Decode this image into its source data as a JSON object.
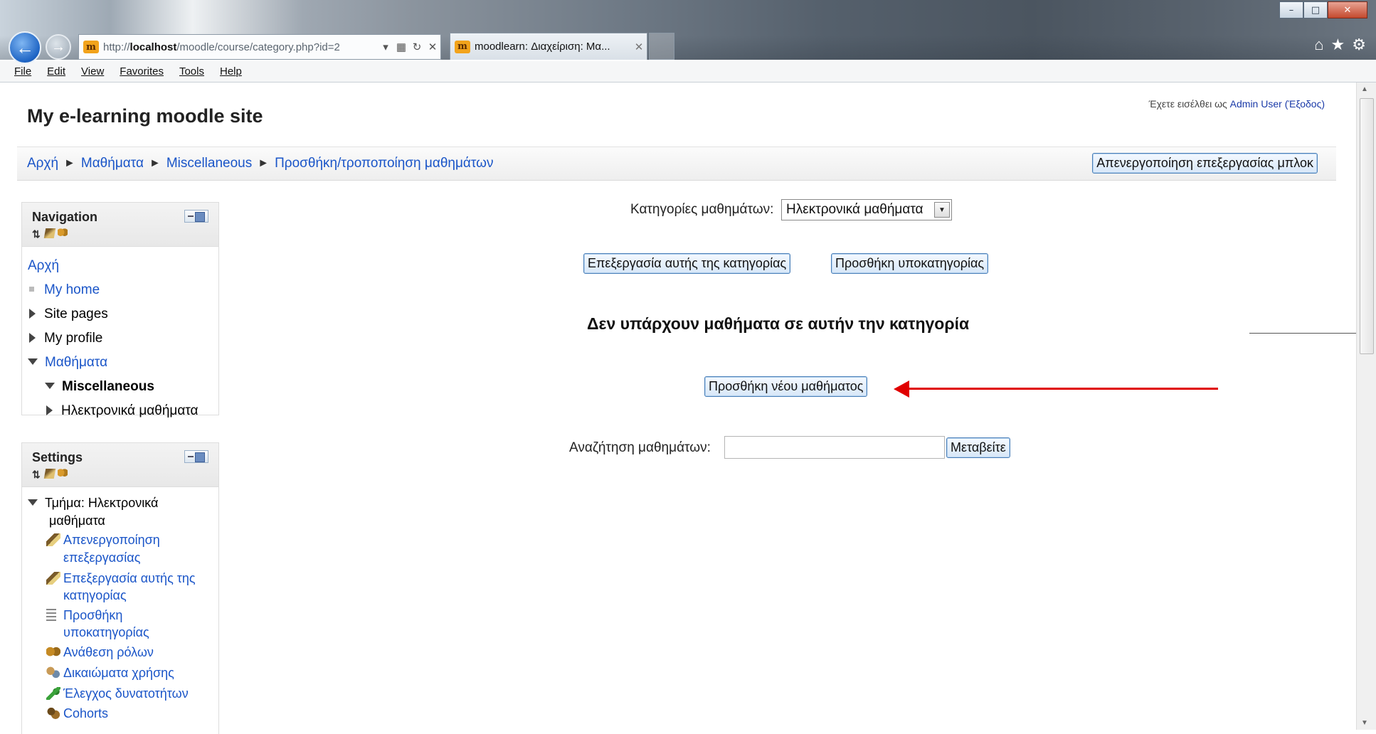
{
  "window": {
    "controls": {
      "minimize": "–",
      "maximize": "□",
      "close": "✕"
    }
  },
  "browser": {
    "url_prefix": "http://",
    "url_host": "localhost",
    "url_path": "/moodle/course/category.php?id=2",
    "tab_title": "moodlearn: Διαχείριση: Μα...",
    "icons": [
      "back-icon",
      "forward-icon",
      "home-icon",
      "favorites-star-icon",
      "settings-gear-icon"
    ]
  },
  "menubar": [
    "File",
    "Edit",
    "View",
    "Favorites",
    "Tools",
    "Help"
  ],
  "header": {
    "site_title": "My e-learning moodle site",
    "login_prefix": "Έχετε εισέλθει ως ",
    "login_user": "Admin User",
    "logout": "(Έξοδος)"
  },
  "breadcrumb": [
    "Αρχή",
    "Μαθήματα",
    "Miscellaneous",
    "Προσθήκη/τροποποίηση μαθημάτων"
  ],
  "blocks_button": "Απενεργοποίηση επεξεργασίας μπλοκ",
  "navigation": {
    "title": "Navigation",
    "home": "Αρχή",
    "my_home": "My home",
    "site_pages": "Site pages",
    "my_profile": "My profile",
    "courses": "Μαθήματα",
    "miscellaneous": "Miscellaneous",
    "elearning": "Ηλεκτρονικά μαθήματα"
  },
  "settings": {
    "title": "Settings",
    "category_line1": "Τμήμα: Ηλεκτρονικά",
    "category_line2": "μαθήματα",
    "items": [
      {
        "line1": "Απενεργοποίηση",
        "line2": "επεξεργασίας",
        "icon": "edit-icon"
      },
      {
        "line1": "Επεξεργασία αυτής της",
        "line2": "κατηγορίας",
        "icon": "edit-icon"
      },
      {
        "line1": "Προσθήκη",
        "line2": "υποκατηγορίας",
        "icon": "add-subcategory-icon"
      },
      {
        "line1": "Ανάθεση ρόλων",
        "line2": "",
        "icon": "assign-roles-icon"
      },
      {
        "line1": "Δικαιώματα χρήσης",
        "line2": "",
        "icon": "permissions-icon"
      },
      {
        "line1": "Έλεγχος δυνατοτήτων",
        "line2": "",
        "icon": "check-permissions-icon"
      },
      {
        "line1": "Cohorts",
        "line2": "",
        "icon": "cohorts-icon"
      }
    ]
  },
  "main": {
    "category_label": "Κατηγορίες μαθημάτων:",
    "category_selected": "Ηλεκτρονικά μαθήματα",
    "edit_category_button": "Επεξεργασία αυτής της κατηγορίας",
    "add_subcategory_button": "Προσθήκη υποκατηγορίας",
    "no_courses_message": "Δεν υπάρχουν μαθήματα σε αυτήν την κατηγορία",
    "add_course_button": "Προσθήκη νέου μαθήματος",
    "search_label": "Αναζήτηση μαθημάτων:",
    "search_value": "",
    "go_button": "Μεταβείτε"
  },
  "colors": {
    "link": "#1a55c8",
    "annotation_arrow": "#e00000",
    "button_border": "#4a7fb8"
  }
}
